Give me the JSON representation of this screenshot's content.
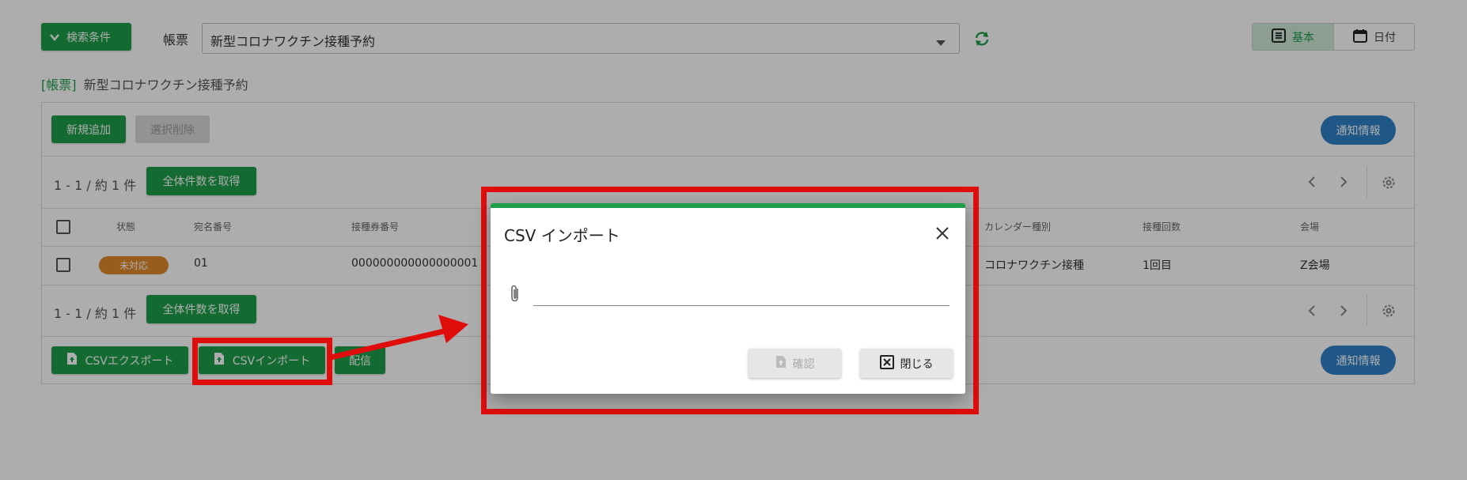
{
  "header": {
    "search_button": "検索条件",
    "form_label": "帳票",
    "form_select_value": "新型コロナワクチン接種予約",
    "view_basic": "基本",
    "view_date": "日付"
  },
  "form_title": {
    "prefix": "[帳票]",
    "name": "新型コロナワクチン接種予約"
  },
  "toolbar": {
    "add_button": "新規追加",
    "delete_button": "選択削除",
    "notify_button": "通知情報"
  },
  "pagination": {
    "range_text": "1 - 1 / 約 1 件",
    "get_total_button": "全体件数を取得"
  },
  "table": {
    "headers": [
      "状態",
      "宛名番号",
      "接種券番号",
      "カレンダー種別",
      "接種回数",
      "会場"
    ],
    "rows": [
      {
        "status": "未対応",
        "address_no": "01",
        "ticket_no": "000000000000000001",
        "calendar_type": "コロナワクチン接種",
        "dose_count": "1回目",
        "venue": "Z会場"
      }
    ]
  },
  "bottom_bar": {
    "csv_export": "CSVエクスポート",
    "csv_import": "CSVインポート",
    "deliver": "配信",
    "notify_button": "通知情報"
  },
  "dialog": {
    "title": "CSV インポート",
    "file_input_value": "",
    "confirm_button": "確認",
    "close_button": "閉じる"
  },
  "colors": {
    "primary_green": "#1e9e4a",
    "notify_blue": "#2f80c8",
    "status_orange": "#e08a2c",
    "annotation_red": "#e00d0d"
  }
}
